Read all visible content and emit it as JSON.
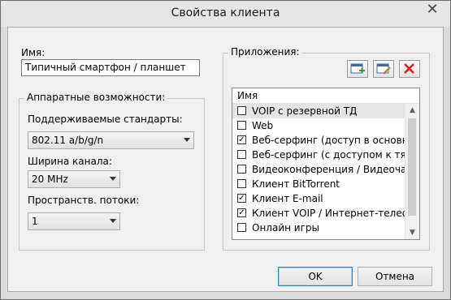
{
  "dialog": {
    "title": "Свойства клиента",
    "close_glyph": "✕"
  },
  "name": {
    "label": "Имя:",
    "value": "Типичный смартфон / планшет"
  },
  "hardware": {
    "legend": "Аппаратные возможности:",
    "standards_label": "Поддерживаемые стандарты:",
    "standards_value": "802.11 a/b/g/n",
    "channel_label": "Ширина канала:",
    "channel_value": "20 MHz",
    "streams_label": "Пространств. потоки:",
    "streams_value": "1"
  },
  "apps": {
    "legend": "Приложения:",
    "toolbar": [
      "add-icon",
      "edit-icon",
      "delete-icon"
    ],
    "column_header": "Имя",
    "items": [
      {
        "label": "VOIP с резервной ТД",
        "checked": false,
        "selected": true
      },
      {
        "label": "Web",
        "checked": false
      },
      {
        "label": "Веб-серфинг (доступ в основно...",
        "checked": true
      },
      {
        "label": "Веб-серфинг (с доступом к тяж...",
        "checked": false
      },
      {
        "label": "Видеоконференция / Видеочат",
        "checked": false
      },
      {
        "label": "Клиент BitTorrent",
        "checked": false
      },
      {
        "label": "Клиент E-mail",
        "checked": true
      },
      {
        "label": "Клиент VOIP / Интернет-телефо...",
        "checked": true
      },
      {
        "label": "Онлайн игры",
        "checked": false
      }
    ]
  },
  "buttons": {
    "ok": "OK",
    "cancel": "Отмена"
  }
}
